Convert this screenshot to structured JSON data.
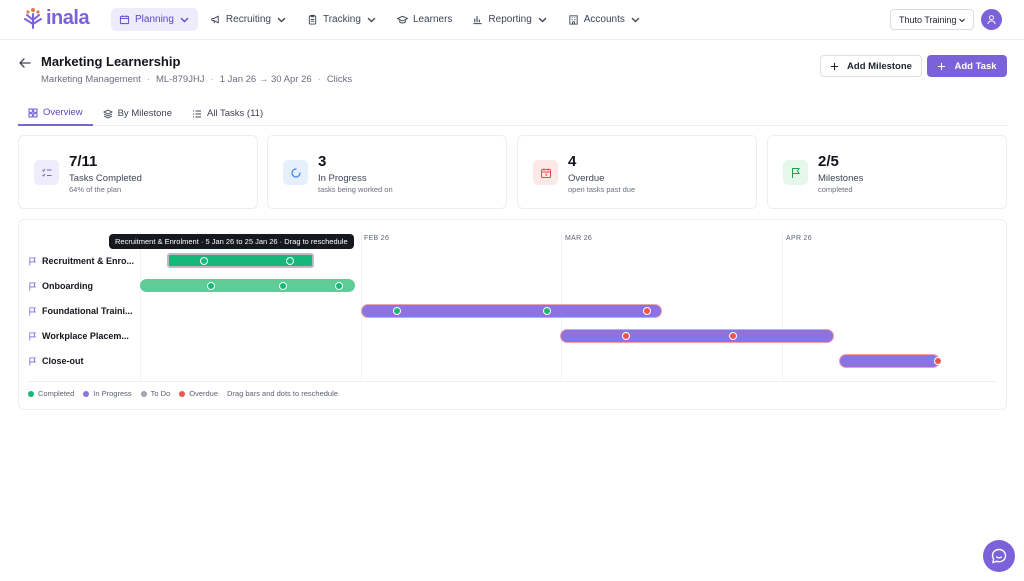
{
  "app": {
    "logo_text": "inala"
  },
  "nav": {
    "items": [
      {
        "label": "Planning",
        "icon": "calendar-icon",
        "dropdown": true,
        "active": true
      },
      {
        "label": "Recruiting",
        "icon": "megaphone-icon",
        "dropdown": true
      },
      {
        "label": "Tracking",
        "icon": "clipboard-icon",
        "dropdown": true
      },
      {
        "label": "Learners",
        "icon": "graduation-cap-icon",
        "dropdown": false
      },
      {
        "label": "Reporting",
        "icon": "bar-chart-icon",
        "dropdown": true
      },
      {
        "label": "Accounts",
        "icon": "building-icon",
        "dropdown": true
      }
    ],
    "org_selector": "Thuto Training"
  },
  "header": {
    "title": "Marketing Learnership",
    "program": "Marketing Management",
    "code": "ML-879JHJ",
    "dates": "1 Jan 26 → 30 Apr 26",
    "client": "Clicks",
    "add_milestone_label": "Add Milestone",
    "add_task_label": "Add Task"
  },
  "tabs": [
    {
      "label": "Overview",
      "icon": "grid-icon",
      "active": true
    },
    {
      "label": "By Milestone",
      "icon": "layers-icon"
    },
    {
      "label": "All Tasks (11)",
      "icon": "list-icon"
    }
  ],
  "stats": [
    {
      "value": "7/11",
      "label": "Tasks Completed",
      "sub": "64% of the plan",
      "icon": "checklist-icon",
      "color": "#7b62d9",
      "bg": "#efecfb"
    },
    {
      "value": "3",
      "label": "In Progress",
      "sub": "tasks being worked on",
      "icon": "spinner-icon",
      "color": "#3b82f6",
      "bg": "#e6f0fd"
    },
    {
      "value": "4",
      "label": "Overdue",
      "sub": "open tasks past due",
      "icon": "alarm-icon",
      "color": "#e5484d",
      "bg": "#fde8e8"
    },
    {
      "value": "2/5",
      "label": "Milestones",
      "sub": "completed",
      "icon": "flag-icon",
      "color": "#16a34a",
      "bg": "#e4f7ea"
    }
  ],
  "gantt": {
    "months": [
      "FEB 26",
      "MAR 26",
      "APR 26"
    ],
    "rows": [
      {
        "label": "Recruitment & Enro...",
        "status": "selected"
      },
      {
        "label": "Onboarding",
        "status": "completed"
      },
      {
        "label": "Foundational Traini...",
        "status": "in-progress"
      },
      {
        "label": "Workplace Placem...",
        "status": "in-progress"
      },
      {
        "label": "Close-out",
        "status": "in-progress"
      }
    ],
    "tooltip": "Recruitment & Enrolment · 5 Jan 26 to 25 Jan 26 · Drag to reschedule",
    "legend": [
      {
        "label": "Completed",
        "color": "#17b77a"
      },
      {
        "label": "In Progress",
        "color": "#8b73e3"
      },
      {
        "label": "To Do",
        "color": "#a1a5b0"
      },
      {
        "label": "Overdue",
        "color": "#ef5350"
      }
    ],
    "legend_hint": "Drag bars and dots to reschedule"
  }
}
